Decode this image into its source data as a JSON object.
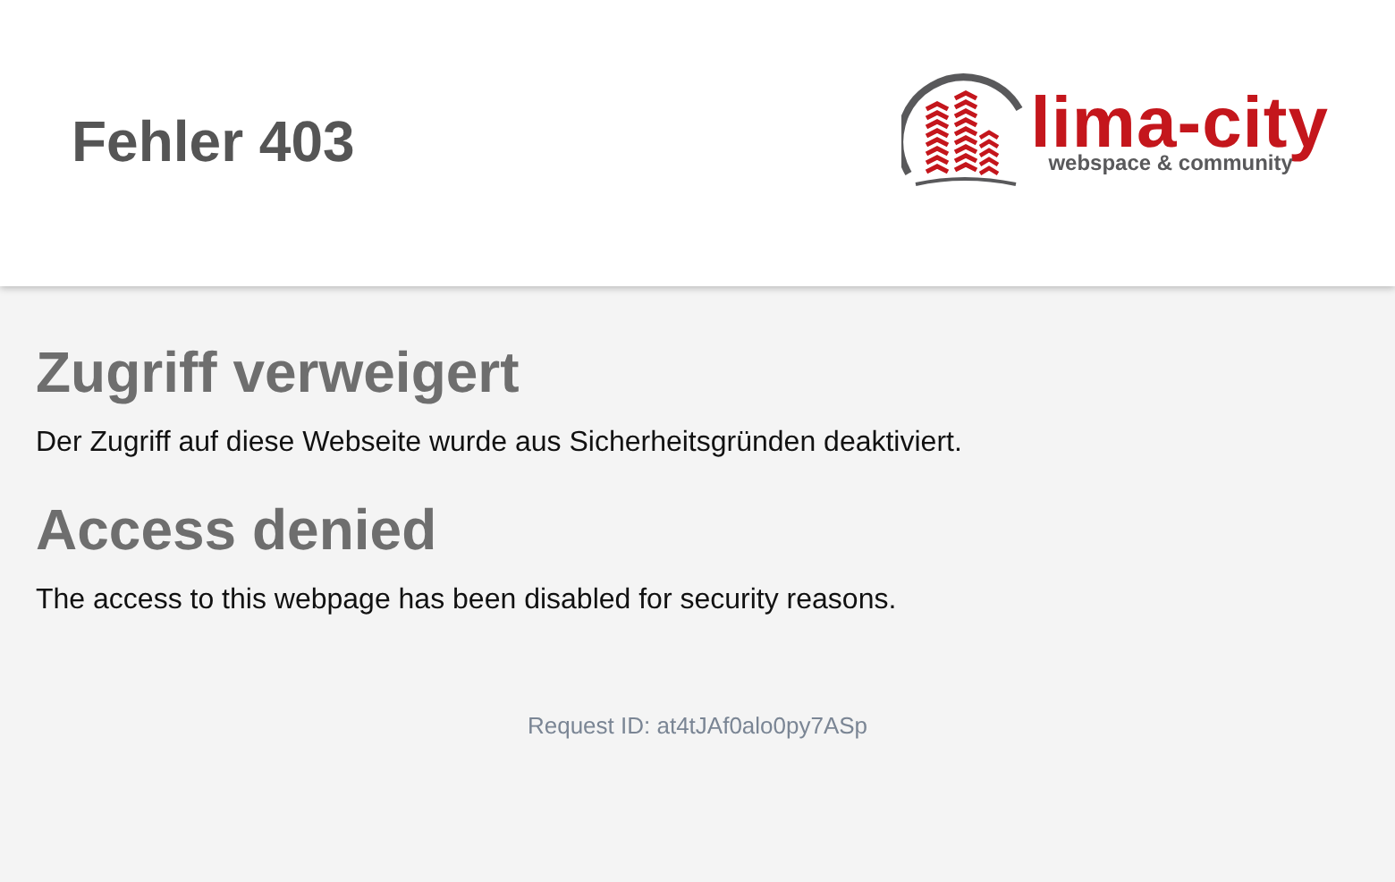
{
  "header": {
    "title": "Fehler 403",
    "logo": {
      "name": "lima-city",
      "tagline": "webspace & community"
    }
  },
  "sections": [
    {
      "heading": "Zugriff verweigert",
      "text": "Der Zugriff auf diese Webseite wurde aus Sicherheitsgründen deaktiviert."
    },
    {
      "heading": "Access denied",
      "text": "The access to this webpage has been disabled for security reasons."
    }
  ],
  "request_id": "Request ID: at4tJAf0alo0py7ASp"
}
